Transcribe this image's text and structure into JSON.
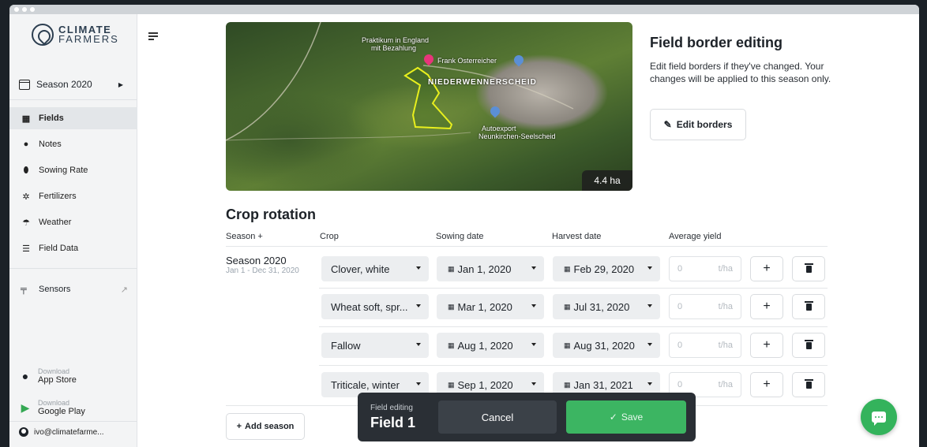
{
  "brand": {
    "line1": "CLIMATE",
    "line2": "FARMERS"
  },
  "sidebar": {
    "season_selector": "Season 2020",
    "items": [
      {
        "label": "Fields",
        "icon": "grid-icon",
        "active": true
      },
      {
        "label": "Notes",
        "icon": "map-pin-icon"
      },
      {
        "label": "Sowing Rate",
        "icon": "seed-icon"
      },
      {
        "label": "Fertilizers",
        "icon": "fertilizer-icon"
      },
      {
        "label": "Weather",
        "icon": "umbrella-icon"
      },
      {
        "label": "Field Data",
        "icon": "database-icon"
      }
    ],
    "sensors": "Sensors",
    "app_store": {
      "small": "Download",
      "big": "App Store"
    },
    "google_play": {
      "small": "Download",
      "big": "Google Play"
    },
    "account": "ivo@climatefarme..."
  },
  "map": {
    "labels": [
      "Praktikum in England",
      "mit Bezahlung",
      "Frank Osterreicher",
      "NIEDERWENNERSCHEID",
      "Autoexport",
      "Neunkirchen-Seelscheid"
    ],
    "area": "4.4 ha"
  },
  "border_editing": {
    "title": "Field border editing",
    "text": "Edit field borders if they've changed. Your changes will be applied to this season only.",
    "button": "Edit borders"
  },
  "crop_rotation": {
    "title": "Crop rotation",
    "columns": [
      "Season +",
      "Crop",
      "Sowing date",
      "Harvest date",
      "Average yield"
    ],
    "season": {
      "name": "Season 2020",
      "range": "Jan 1 - Dec 31, 2020"
    },
    "rows": [
      {
        "crop": "Clover, white",
        "sowing": "Jan 1, 2020",
        "harvest": "Feb 29, 2020",
        "yield_placeholder": "0",
        "unit": "t/ha"
      },
      {
        "crop": "Wheat soft, spr...",
        "sowing": "Mar 1, 2020",
        "harvest": "Jul 31, 2020",
        "yield_placeholder": "0",
        "unit": "t/ha"
      },
      {
        "crop": "Fallow",
        "sowing": "Aug 1, 2020",
        "harvest": "Aug 31, 2020",
        "yield_placeholder": "0",
        "unit": "t/ha"
      },
      {
        "crop": "Triticale, winter",
        "sowing": "Sep 1, 2020",
        "harvest": "Jan 31, 2021",
        "yield_placeholder": "0",
        "unit": "t/ha"
      }
    ],
    "add_season": "Add season",
    "add_symbol": "+"
  },
  "edit_bar": {
    "label": "Field editing",
    "field": "Field 1",
    "cancel": "Cancel",
    "save": "Save"
  },
  "colors": {
    "accent_green": "#3cb562",
    "field_outline": "#e8ef1d",
    "dark_bar": "#2a2f35"
  }
}
